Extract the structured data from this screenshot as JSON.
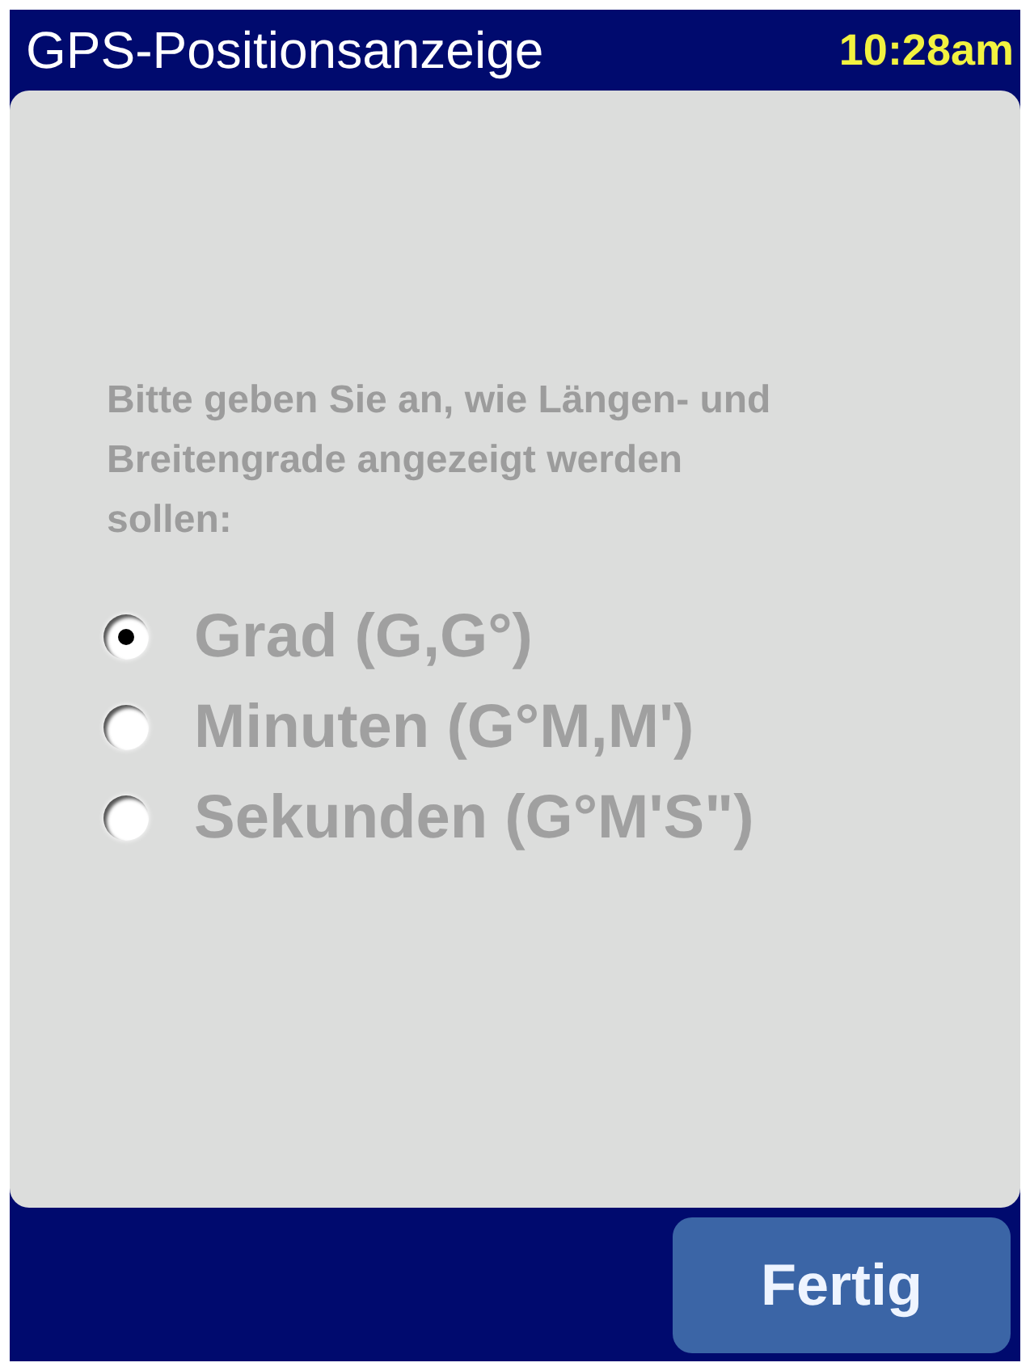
{
  "title_bar": {
    "title": "GPS-Positionsanzeige",
    "time": "10:28am"
  },
  "prompt": "Bitte geben Sie an, wie Längen- und Breitengrade angezeigt werden sollen:",
  "options": [
    {
      "label": "Grad (G,G°)",
      "selected": true
    },
    {
      "label": "Minuten (G°M,M')",
      "selected": false
    },
    {
      "label": "Sekunden (G°M'S\")",
      "selected": false
    }
  ],
  "buttons": [
    "Fertig"
  ]
}
